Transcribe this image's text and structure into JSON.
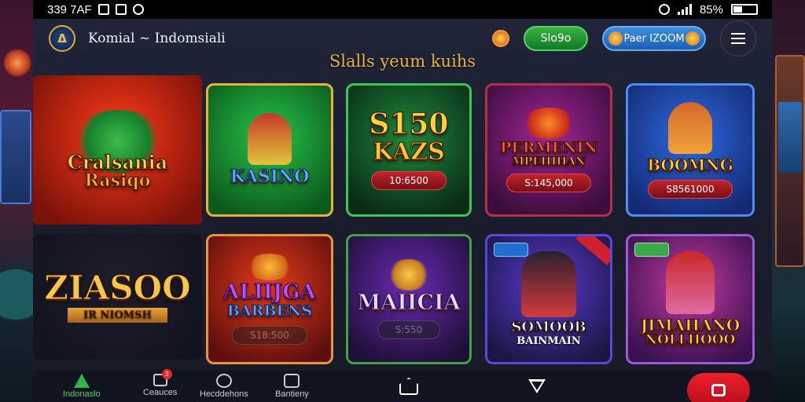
{
  "status_bar": {
    "time": "339 7AF",
    "battery_percent": "85%",
    "battery_level": 0.36
  },
  "header": {
    "brand": "Komial ~ Indomsiali",
    "logo_text": "Δ",
    "green_button": "Slo9o",
    "blue_button": "Paer IZOOM"
  },
  "section_title": "Slalls yeum kuihs",
  "tiles": [
    {
      "title": "Cralsania",
      "subtitle": "Rasiqo",
      "price": "",
      "colors": [
        "#ff3a18",
        "#7b1209"
      ]
    },
    {
      "title": "KASINO",
      "subtitle": "",
      "price": "",
      "colors": [
        "#27c44a",
        "#0b5a1c"
      ]
    },
    {
      "title": "S150",
      "subtitle": "KAZS",
      "price": "10:6500",
      "colors": [
        "#1d8a3c",
        "#0a2b16"
      ]
    },
    {
      "title": "PERMENIN",
      "subtitle": "MPEHIHAN",
      "price": "S:145,000",
      "colors": [
        "#a2259a",
        "#3a0d3a"
      ]
    },
    {
      "title": "BOOMNG",
      "subtitle": "",
      "price": "S8561000",
      "colors": [
        "#2d6ae0",
        "#142a75"
      ]
    },
    {
      "title": "ZIASOO",
      "subtitle": "IR NIOMSH",
      "price": "",
      "colors": [
        "#1e1d2c",
        "#121320"
      ]
    },
    {
      "title": "ALIIJGA",
      "subtitle": "BARBENS",
      "price": "S18:500",
      "colors": [
        "#e83a1a",
        "#5e0f0d"
      ]
    },
    {
      "title": "MAIICIA",
      "subtitle": "",
      "price": "S:550",
      "colors": [
        "#6a2ab2",
        "#1f0f3a"
      ]
    },
    {
      "title": "SOMOOB",
      "subtitle": "BAINMAIN",
      "price": "",
      "colors": [
        "#5b3ad4",
        "#1b1744"
      ]
    },
    {
      "title": "JIMAHANO",
      "subtitle": "NOLLHOOO",
      "price": "",
      "colors": [
        "#c13aa0",
        "#3a1050"
      ]
    }
  ],
  "bottom_nav": [
    {
      "label": "Indonaslo",
      "icon": "home-triangle-icon"
    },
    {
      "label": "Ceauces",
      "icon": "inbox-icon",
      "badge": "3"
    },
    {
      "label": "Hecddehons",
      "icon": "disc-icon"
    },
    {
      "label": "Bantieny",
      "icon": "wallet-icon"
    }
  ]
}
